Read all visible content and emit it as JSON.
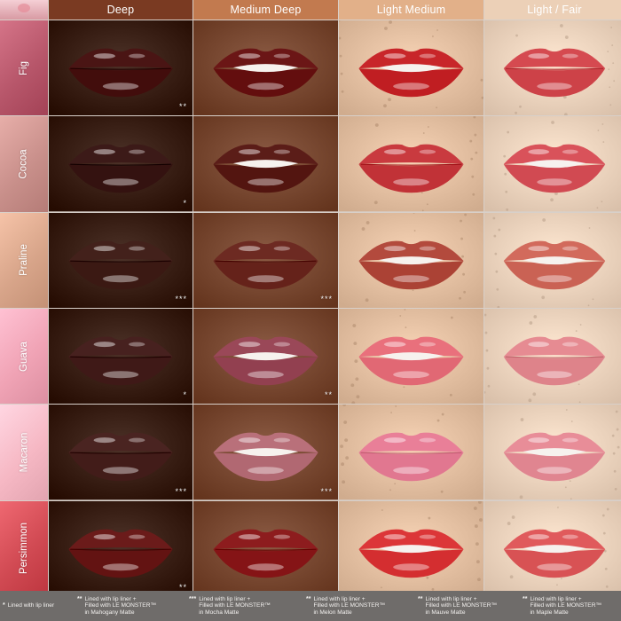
{
  "columns": [
    {
      "label": "Deep",
      "color": "#7a3a22"
    },
    {
      "label": "Medium Deep",
      "color": "#c27a4f"
    },
    {
      "label": "Light Medium",
      "color": "#e2b089"
    },
    {
      "label": "Light / Fair",
      "color": "#ecd0b7"
    }
  ],
  "rows": [
    {
      "label": "Fig",
      "swatch": "#b7566a",
      "lips": [
        "#4a1514",
        "#6b1616",
        "#c8262a",
        "#d54a50"
      ],
      "marks": [
        "**",
        "",
        "",
        ""
      ]
    },
    {
      "label": "Cocoa",
      "swatch": "#c9908b",
      "lips": [
        "#3c1a18",
        "#5b1d18",
        "#c93a3f",
        "#d9525a"
      ],
      "marks": [
        "*",
        "",
        "",
        ""
      ]
    },
    {
      "label": "Praline",
      "swatch": "#d8a58a",
      "lips": [
        "#43211b",
        "#6d2a22",
        "#b34a3d",
        "#d26a5c"
      ],
      "marks": [
        "***",
        "***",
        "",
        ""
      ]
    },
    {
      "label": "Guava",
      "swatch": "#f0a3b5",
      "lips": [
        "#47211f",
        "#9a4858",
        "#e9707c",
        "#e68b92"
      ],
      "marks": [
        "*",
        "**",
        "",
        ""
      ]
    },
    {
      "label": "Macaron",
      "swatch": "#f6b8c4",
      "lips": [
        "#4a2421",
        "#b9707a",
        "#e97f98",
        "#e88d98"
      ],
      "marks": [
        "***",
        "***",
        "",
        ""
      ]
    },
    {
      "label": "Persimmon",
      "swatch": "#d14a53",
      "lips": [
        "#6b1b1a",
        "#8d1c1e",
        "#dc3638",
        "#e05a5c"
      ],
      "marks": [
        "**",
        "",
        "",
        ""
      ]
    }
  ],
  "skin_tones": [
    "#3b2117",
    "#7a4a33",
    "#e6c2a4",
    "#efd6c0"
  ],
  "footer": [
    {
      "mark": "*",
      "lines": [
        "Lined with lip liner"
      ]
    },
    {
      "mark": "**",
      "lines": [
        "Lined with lip liner +",
        "Filled with LE MONSTER™",
        "in Mahogany Matte"
      ]
    },
    {
      "mark": "***",
      "lines": [
        "Lined with lip liner +",
        "Filled with LE MONSTER™",
        "in Mocha Matte"
      ]
    },
    {
      "mark": "**",
      "lines": [
        "Lined with lip liner +",
        "Filled with LE MONSTER™",
        "in Melon Matte"
      ]
    },
    {
      "mark": "**",
      "lines": [
        "Lined with lip liner +",
        "Filled with LE MONSTER™",
        "in Mauve Matte"
      ]
    },
    {
      "mark": "**",
      "lines": [
        "Lined with lip liner +",
        "Filled with LE MONSTER™",
        "in Maple Matte"
      ]
    }
  ]
}
